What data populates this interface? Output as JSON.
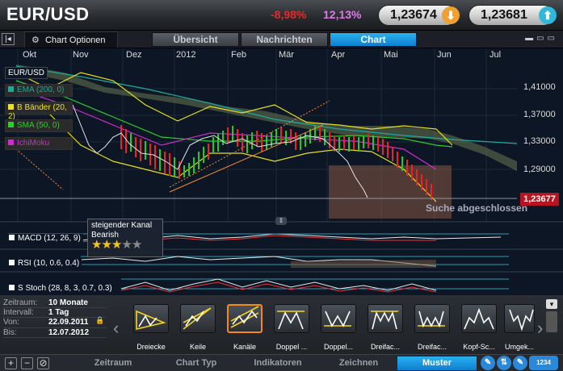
{
  "header": {
    "pair": "EUR/USD",
    "change_neg": "-8,98%",
    "change_pos": "12,13%",
    "sell": "1,23674",
    "buy": "1,23681"
  },
  "tabbar": {
    "chart_options": "Chart Optionen",
    "tabs": [
      "Übersicht",
      "Nachrichten",
      "Chart"
    ],
    "active_tab": "Chart"
  },
  "chart": {
    "instrument_label": "EUR/USD",
    "indicators": [
      {
        "label": "EMA (200, 0)",
        "color": "#1fa89a"
      },
      {
        "label": "B Bänder (20, 2)",
        "color": "#f0e21a"
      },
      {
        "label": "SMA (50, 0)",
        "color": "#2ecc2e"
      },
      {
        "label": "IchiMoku",
        "color": "#d02ad0"
      }
    ],
    "x_labels": [
      "Okt",
      "Nov",
      "Dez",
      "2012",
      "Feb",
      "Mär",
      "Apr",
      "Mai",
      "Jun",
      "Jul"
    ],
    "y_labels": [
      "1,41000",
      "1,37000",
      "1,33000",
      "1,29000"
    ],
    "current_price": "1,23677",
    "callout_title": "steigender Kanal",
    "callout_subtitle": "Bearish",
    "rating_stars": 3,
    "rating_max": 5,
    "search_status": "Suche abgeschlossen",
    "subpanels": [
      "MACD (12, 26, 9)",
      "RSI (10, 0.6, 0.4)",
      "S Stoch (28, 8, 3, 0.7, 0.3)"
    ]
  },
  "info": {
    "rows": [
      {
        "key": "Zeitraum:",
        "value": "10 Monate"
      },
      {
        "key": "Intervall:",
        "value": "1 Tag"
      },
      {
        "key": "Von:",
        "value": "22.09.2011"
      },
      {
        "key": "Bis:",
        "value": "12.07.2012"
      }
    ]
  },
  "patterns": {
    "items": [
      "Dreiecke",
      "Keile",
      "Kanäle",
      "Doppel ...",
      "Doppel...",
      "Dreifac...",
      "Dreifac...",
      "Kopf-Sc...",
      "Umgek..."
    ],
    "selected": "Kanäle"
  },
  "bottom_tabs": {
    "tabs": [
      "Zeitraum",
      "Chart Typ",
      "Indikatoren",
      "Zeichnen",
      "Muster"
    ],
    "active_tab": "Muster",
    "badge": "1234"
  }
}
